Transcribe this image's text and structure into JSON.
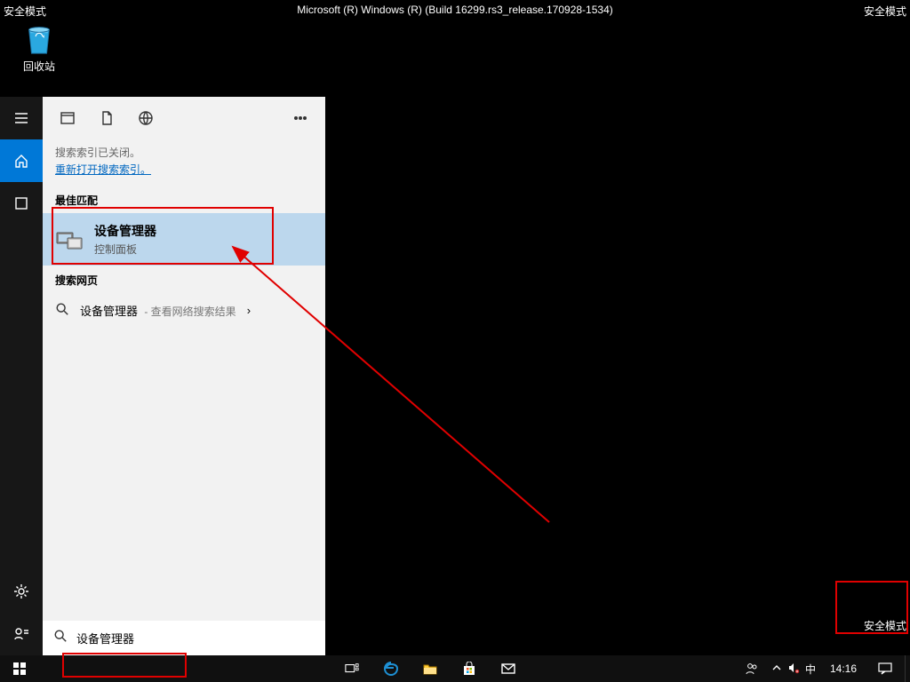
{
  "safe_mode_label": "安全模式",
  "build_string": "Microsoft (R) Windows (R) (Build 16299.rs3_release.170928-1534)",
  "desktop": {
    "recycle_bin": "回收站"
  },
  "search_panel": {
    "index_closed_msg": "搜索索引已关闭。",
    "reopen_link": "重新打开搜索索引。",
    "best_match_header": "最佳匹配",
    "best_match": {
      "title": "设备管理器",
      "subtitle": "控制面板"
    },
    "web_header": "搜索网页",
    "web_item": {
      "term": "设备管理器",
      "suffix": " - 查看网络搜索结果"
    },
    "search_value": "设备管理器"
  },
  "taskbar": {
    "ime": "中",
    "clock": "14:16"
  }
}
